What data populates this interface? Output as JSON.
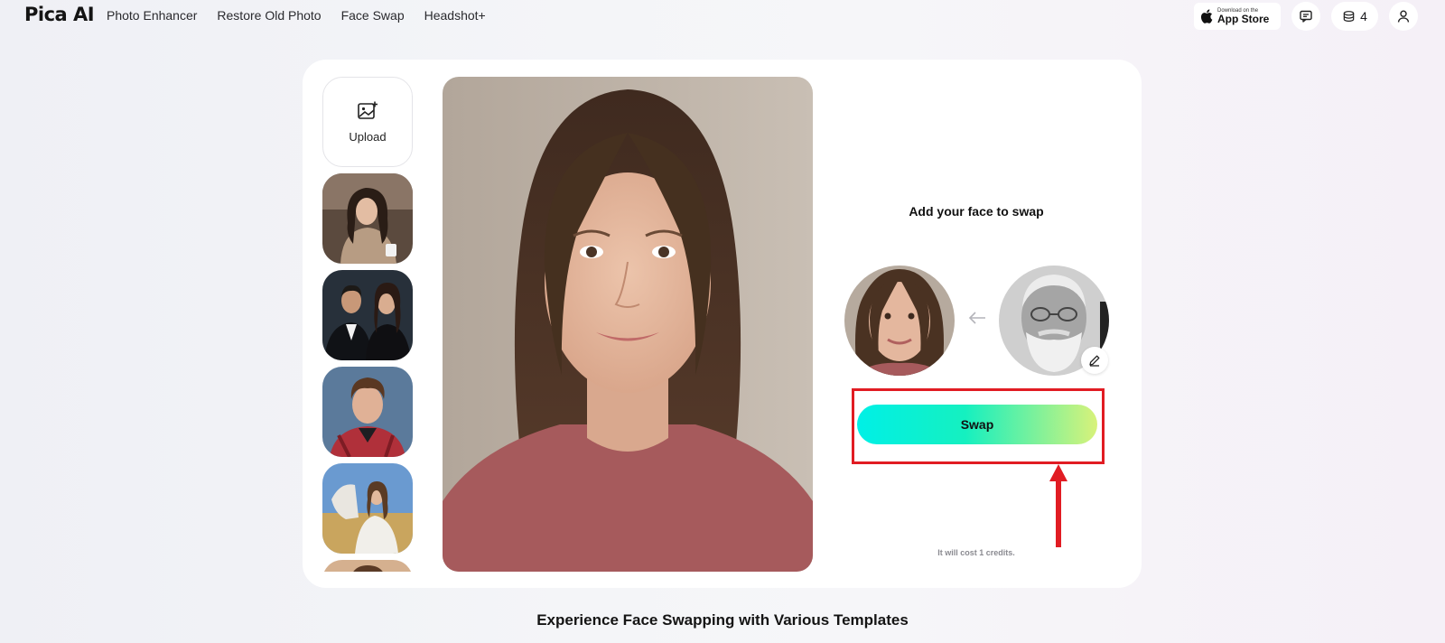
{
  "header": {
    "logo": "Pica AI",
    "nav": [
      "Photo Enhancer",
      "Restore Old Photo",
      "Face Swap",
      "Headshot+"
    ],
    "appstore_small": "Download on the",
    "appstore_big": "App Store",
    "credits_count": "4"
  },
  "editor": {
    "upload_label": "Upload",
    "panel_title": "Add your face to swap",
    "swap_label": "Swap",
    "cost_note": "It will cost 1 credits."
  },
  "section_heading": "Experience Face Swapping with Various Templates",
  "colors": {
    "accent_start": "#00f0e6",
    "accent_end": "#d8f27a",
    "annotation_red": "#e11c23"
  },
  "icons": {
    "upload": "image-plus-icon",
    "chat": "message-icon",
    "credits": "coin-stack-icon",
    "user": "user-icon",
    "edit": "pencil-icon",
    "arrow": "arrow-left-icon"
  }
}
